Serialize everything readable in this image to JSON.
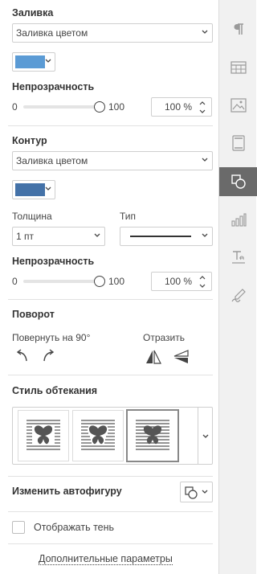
{
  "fill": {
    "heading": "Заливка",
    "type_value": "Заливка цветом",
    "color": "#5b9bd5",
    "opacity_label": "Непрозрачность",
    "slider_min": "0",
    "slider_max": "100",
    "opacity_value": "100 %",
    "opacity_level": 1.0
  },
  "stroke": {
    "heading": "Контур",
    "type_value": "Заливка цветом",
    "color": "#4472a8",
    "width_label": "Толщина",
    "width_value": "1 пт",
    "type_label": "Тип",
    "opacity_label": "Непрозрачность",
    "slider_min": "0",
    "slider_max": "100",
    "opacity_value": "100 %",
    "opacity_level": 1.0
  },
  "rotation": {
    "heading": "Поворот",
    "rotate_label": "Повернуть на 90°",
    "flip_label": "Отразить"
  },
  "wrap": {
    "heading": "Стиль обтекания"
  },
  "autoshape": {
    "label": "Изменить автофигуру"
  },
  "shadow": {
    "label": "Отображать тень",
    "checked": false
  },
  "advanced": {
    "label": "Дополнительные параметры"
  },
  "rightbar": {
    "items": [
      {
        "icon": "paragraph-icon"
      },
      {
        "icon": "table-icon"
      },
      {
        "icon": "image-icon"
      },
      {
        "icon": "header-footer-icon"
      },
      {
        "icon": "shape-icon",
        "active": true
      },
      {
        "icon": "chart-icon"
      },
      {
        "icon": "textart-icon"
      },
      {
        "icon": "signature-icon"
      }
    ]
  },
  "colors": {
    "active_bar": "#6a6a6a",
    "icon_gray": "#9a9a9a"
  }
}
